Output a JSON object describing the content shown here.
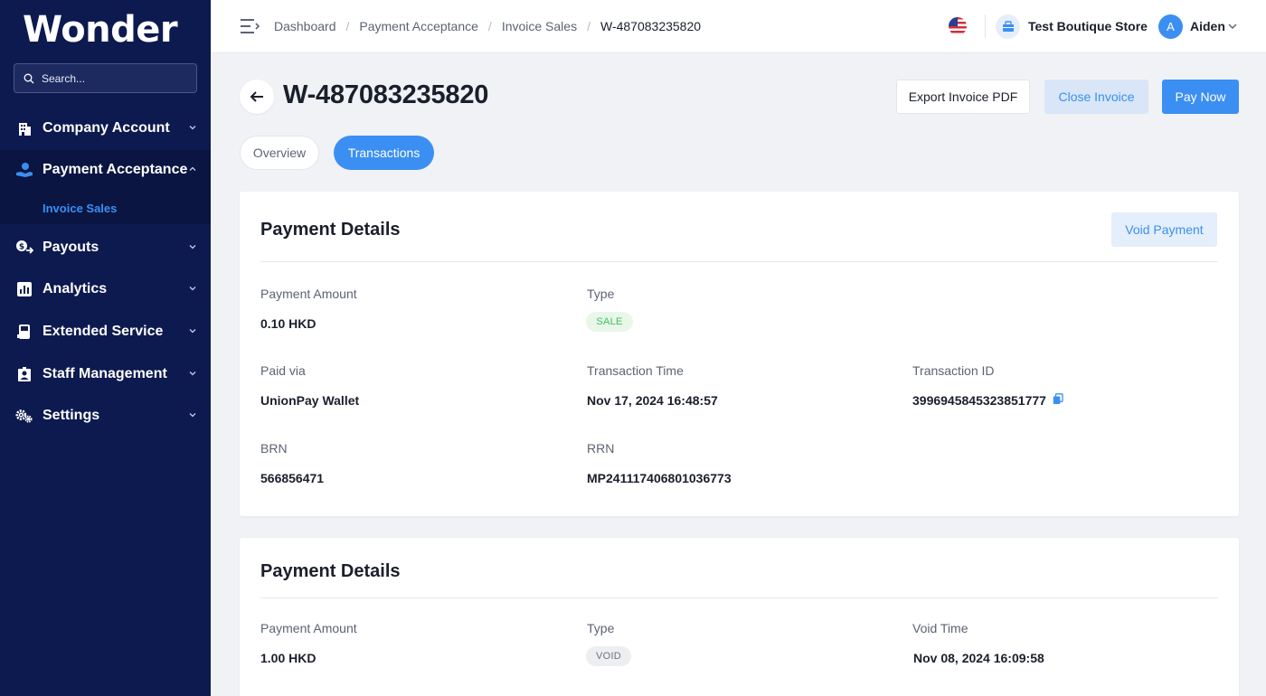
{
  "sidebar": {
    "logo": "Wonder",
    "search_placeholder": "Search...",
    "items": [
      {
        "label": "Company Account",
        "icon": "building-icon"
      },
      {
        "label": "Payment Acceptance",
        "icon": "hand-coin-icon"
      },
      {
        "label": "Payouts",
        "icon": "money-out-icon"
      },
      {
        "label": "Analytics",
        "icon": "bar-chart-icon"
      },
      {
        "label": "Extended Service",
        "icon": "pos-terminal-icon"
      },
      {
        "label": "Staff Management",
        "icon": "staff-icon"
      },
      {
        "label": "Settings",
        "icon": "gears-icon"
      }
    ],
    "active_sub_item": "Invoice Sales"
  },
  "topbar": {
    "breadcrumbs": [
      "Dashboard",
      "Payment Acceptance",
      "Invoice Sales",
      "W-487083235820"
    ],
    "store_name": "Test Boutique Store",
    "avatar_initial": "A",
    "user_name": "Aiden"
  },
  "header": {
    "title": "W-487083235820",
    "export_label": "Export Invoice PDF",
    "close_label": "Close Invoice",
    "pay_label": "Pay Now"
  },
  "tabs": {
    "overview": "Overview",
    "transactions": "Transactions"
  },
  "payments": [
    {
      "title": "Payment Details",
      "void_button": "Void Payment",
      "amount_label": "Payment Amount",
      "amount": "0.10 HKD",
      "type_label": "Type",
      "type": "SALE",
      "paid_via_label": "Paid via",
      "paid_via": "UnionPay Wallet",
      "time_label": "Transaction Time",
      "time": "Nov 17, 2024 16:48:57",
      "txn_id_label": "Transaction ID",
      "txn_id": "3996945845323851777",
      "brn_label": "BRN",
      "brn": "566856471",
      "rrn_label": "RRN",
      "rrn": "MP241117406801036773"
    },
    {
      "title": "Payment Details",
      "amount_label": "Payment Amount",
      "amount": "1.00 HKD",
      "type_label": "Type",
      "type": "VOID",
      "void_time_label": "Void Time",
      "void_time": "Nov 08, 2024 16:09:58"
    }
  ],
  "colors": {
    "sidebar_bg": "#0d1a4f",
    "accent": "#3b8ff2",
    "sale_green": "#3fbf5b",
    "page_bg": "#f0f2f5"
  }
}
